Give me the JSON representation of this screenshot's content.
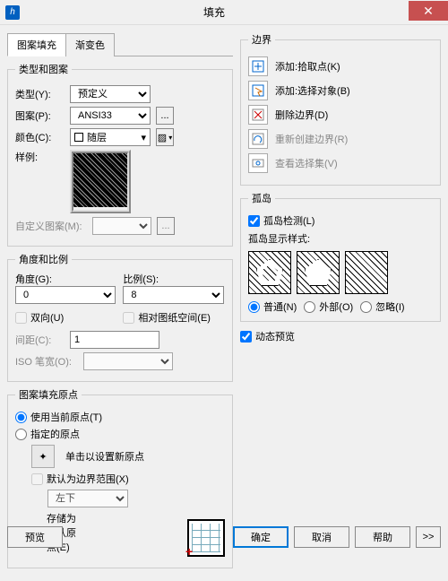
{
  "window": {
    "title": "填充"
  },
  "tabs": {
    "hatch": "图案填充",
    "gradient": "渐变色"
  },
  "typeGroup": {
    "legend": "类型和图案",
    "typeLabel": "类型(Y):",
    "typeValue": "预定义",
    "patternLabel": "图案(P):",
    "patternValue": "ANSI33",
    "patternBtn": "...",
    "colorLabel": "颜色(C):",
    "colorValue": "随层",
    "sampleLabel": "样例:",
    "customLabel": "自定义图案(M):",
    "customBtn": "..."
  },
  "angleGroup": {
    "legend": "角度和比例",
    "angleLabel": "角度(G):",
    "angleValue": "0",
    "scaleLabel": "比例(S):",
    "scaleValue": "8",
    "doubleLabel": "双向(U)",
    "relativeLabel": "相对图纸空间(E)",
    "spacingLabel": "间距(C):",
    "spacingValue": "1",
    "isoLabel": "ISO 笔宽(O):"
  },
  "originGroup": {
    "legend": "图案填充原点",
    "useCurrent": "使用当前原点(T)",
    "specified": "指定的原点",
    "clickNew": "单击以设置新原点",
    "defaultExtent": "默认为边界范围(X)",
    "position": "左下",
    "storeDefault": "存储为默认原点(E)"
  },
  "boundary": {
    "legend": "边界",
    "addPick": "添加:拾取点(K)",
    "addSelect": "添加:选择对象(B)",
    "remove": "删除边界(D)",
    "recreate": "重新创建边界(R)",
    "viewSel": "查看选择集(V)"
  },
  "island": {
    "legend": "孤岛",
    "detect": "孤岛检测(L)",
    "styleLabel": "孤岛显示样式:",
    "normal": "普通(N)",
    "outer": "外部(O)",
    "ignore": "忽略(I)"
  },
  "dynamic": "动态预览",
  "footer": {
    "preview": "预览",
    "ok": "确定",
    "cancel": "取消",
    "help": "帮助",
    "more": ">>"
  }
}
